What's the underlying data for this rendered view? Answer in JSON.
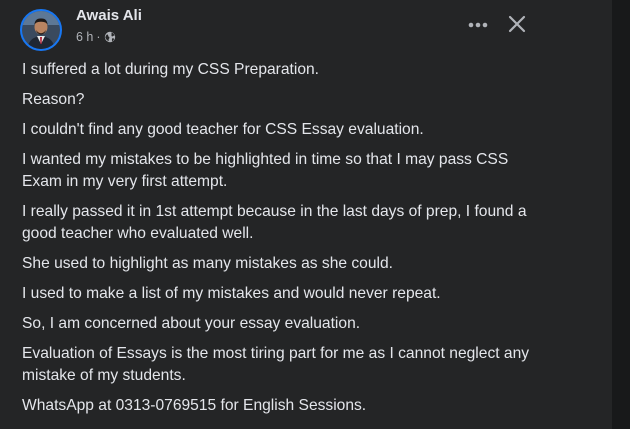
{
  "post": {
    "author": "Awais Ali",
    "time": "6 h",
    "separator": "·",
    "privacy_icon": "globe-icon",
    "more_icon": "more-horizontal-icon",
    "close_icon": "close-icon",
    "paragraphs": [
      "I suffered a lot during my CSS Preparation.",
      "Reason?",
      "I couldn't find any good teacher for CSS Essay evaluation.",
      "I wanted my mistakes to be highlighted in time so that I may pass CSS Exam in my very first attempt.",
      "I really passed it in 1st attempt because in the last days of prep, I found a good teacher who evaluated well.",
      "She used to highlight as many mistakes as she could.",
      "I used to make a list of my mistakes and would never repeat.",
      "So, I am concerned about your essay evaluation.",
      "Evaluation of Essays is the most tiring part for me as I cannot neglect any mistake of my students.",
      "WhatsApp at 0313-0769515 for English Sessions."
    ]
  },
  "colors": {
    "card_background": "#242526",
    "page_background": "#18191a",
    "primary_text": "#e4e6eb",
    "secondary_text": "#b0b3b8",
    "avatar_ring": "#1877f2"
  }
}
